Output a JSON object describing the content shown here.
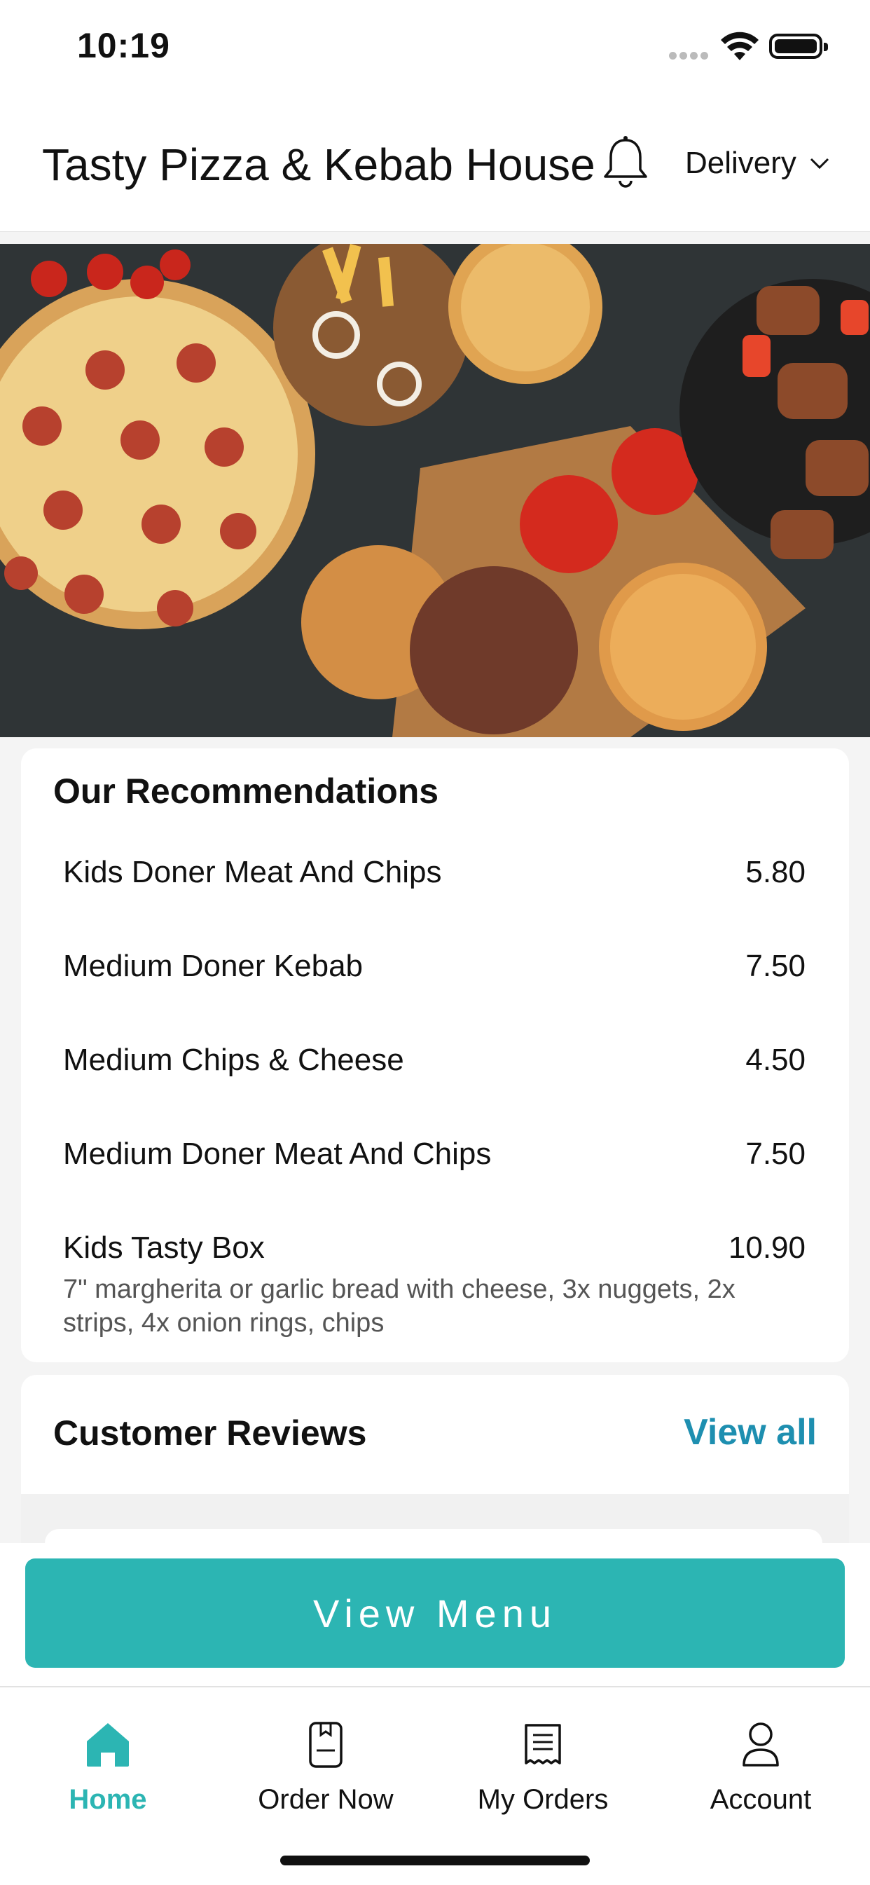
{
  "status_bar": {
    "time": "10:19"
  },
  "header": {
    "title": "Tasty Pizza & Kebab House",
    "mode": "Delivery"
  },
  "recommendations": {
    "title": "Our Recommendations",
    "items": [
      {
        "name": "Kids Doner Meat And Chips",
        "price": "5.80"
      },
      {
        "name": "Medium Doner Kebab",
        "price": "7.50"
      },
      {
        "name": "Medium Chips & Cheese",
        "price": "4.50"
      },
      {
        "name": "Medium Doner Meat And Chips",
        "price": "7.50"
      },
      {
        "name": "Kids Tasty Box",
        "price": "10.90",
        "description": "7\" margherita or garlic bread with cheese, 3x nuggets, 2x strips, 4x onion rings, chips"
      }
    ]
  },
  "reviews": {
    "title": "Customer Reviews",
    "view_all": "View all"
  },
  "cta": {
    "label": "View Menu"
  },
  "tabs": [
    {
      "label": "Home",
      "icon": "home-icon",
      "active": true
    },
    {
      "label": "Order Now",
      "icon": "order-icon",
      "active": false
    },
    {
      "label": "My Orders",
      "icon": "receipt-icon",
      "active": false
    },
    {
      "label": "Account",
      "icon": "user-icon",
      "active": false
    }
  ],
  "colors": {
    "accent": "#2cb5b3",
    "link": "#1e8fb0"
  }
}
